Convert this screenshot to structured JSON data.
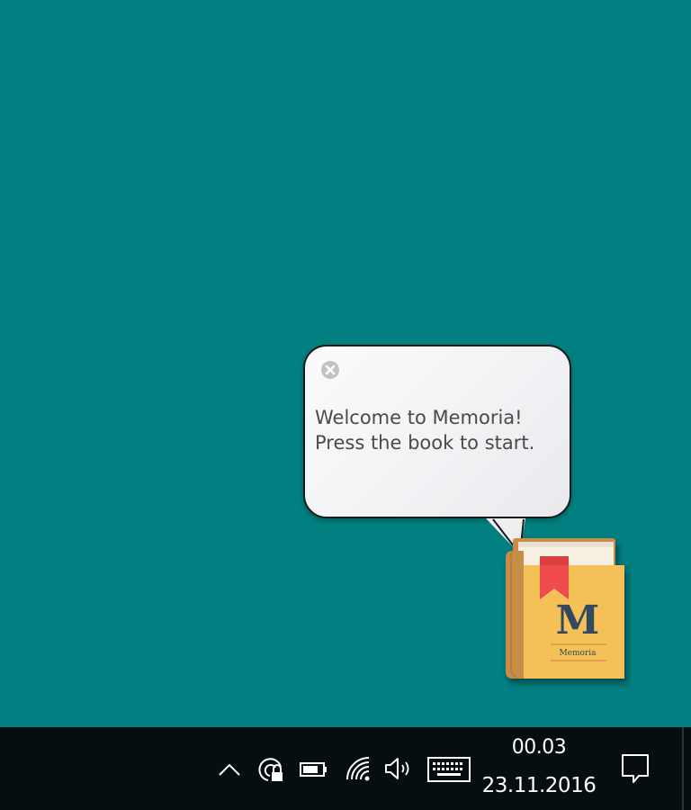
{
  "colors": {
    "desktop": "#027f81",
    "taskbar": "#060e12",
    "bubble_text": "#4a4a4a",
    "book_cover": "#f4c158",
    "book_spine": "#c78d4a",
    "bookmark": "#ef4c4e",
    "letter": "#34495e"
  },
  "bubble": {
    "line1": "Welcome to Memoria!",
    "line2": "Press the book to start.",
    "close_icon": "close-circle-icon"
  },
  "book": {
    "letter": "M",
    "label": "Memoria"
  },
  "taskbar": {
    "icons": [
      "chevron-up-icon",
      "network-lock-icon",
      "battery-icon",
      "wifi-icon",
      "speaker-icon",
      "keyboard-icon",
      "notification-icon"
    ],
    "time": "00.03",
    "date": "23.11.2016"
  }
}
